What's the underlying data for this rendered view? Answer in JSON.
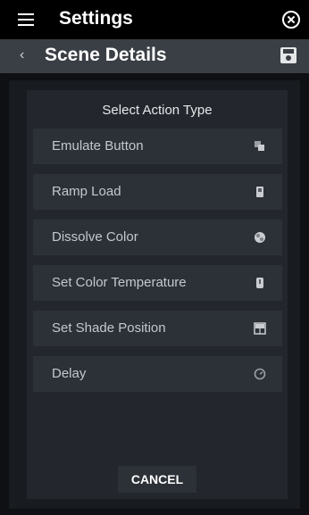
{
  "topbar": {
    "title": "Settings",
    "menu_icon": "hamburger-menu-icon",
    "close_icon": "close-circle-icon"
  },
  "subbar": {
    "title": "Scene Details",
    "back_icon": "chevron-left-icon",
    "back_glyph": "‹",
    "save_icon": "save-disk-icon"
  },
  "dialog": {
    "title": "Select Action Type",
    "options": [
      {
        "label": "Emulate Button",
        "icon": "keypad-buttons-icon"
      },
      {
        "label": "Ramp Load",
        "icon": "dimmer-switch-icon"
      },
      {
        "label": "Dissolve Color",
        "icon": "color-wheel-icon"
      },
      {
        "label": "Set Color Temperature",
        "icon": "temperature-switch-icon"
      },
      {
        "label": "Set Shade Position",
        "icon": "window-shade-icon"
      },
      {
        "label": "Delay",
        "icon": "timer-icon"
      }
    ],
    "cancel_label": "CANCEL"
  },
  "colors": {
    "topbar_bg": "#000000",
    "subbar_bg": "#3a3f45",
    "dialog_bg": "#23272d",
    "option_bg": "#2c3138",
    "option_text": "#c4c8cd"
  }
}
